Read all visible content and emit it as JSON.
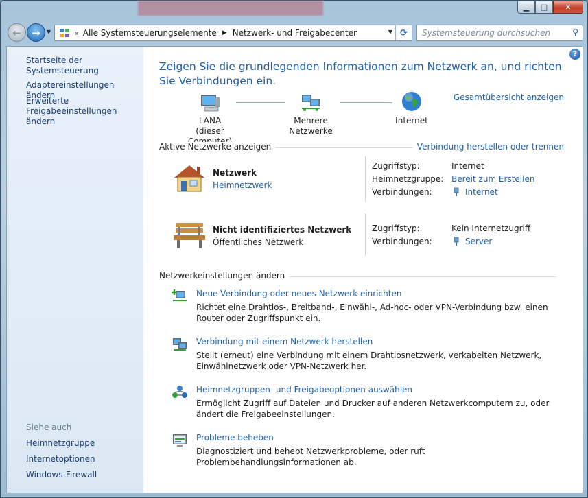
{
  "window": {
    "controls": {
      "minimize": "▁",
      "maximize": "□",
      "close": "✕"
    }
  },
  "nav": {
    "back_icon": "←",
    "forward_icon": "→",
    "recent_icon": "▼",
    "address_chevron": "«",
    "breadcrumbs": [
      "Alle Systemsteuerungselemente",
      "Netzwerk- und Freigabecenter"
    ],
    "crumb_separator": "▶",
    "dropdown_icon": "▼",
    "refresh_icon": "⟳",
    "search_placeholder": "Systemsteuerung durchsuchen",
    "search_icon": "⚲"
  },
  "sidebar": {
    "home": "Startseite der Systemsteuerung",
    "adapter": "Adaptereinstellungen ändern",
    "sharing": "Erweiterte Freigabeeinstellungen ändern",
    "see_also": "Siehe auch",
    "see_also_links": [
      "Heimnetzgruppe",
      "Internetoptionen",
      "Windows-Firewall"
    ]
  },
  "help_icon": "?",
  "main": {
    "title": "Zeigen Sie die grundlegenden Informationen zum Netzwerk an, und richten Sie Verbindungen ein.",
    "map": {
      "computer_line1": "LANA",
      "computer_line2": "(dieser Computer)",
      "network": "Mehrere Netzwerke",
      "internet": "Internet",
      "full_map_link": "Gesamtübersicht anzeigen"
    },
    "active_networks": {
      "heading": "Aktive Netzwerke anzeigen",
      "connect_link": "Verbindung herstellen oder trennen",
      "networks": [
        {
          "name": "Netzwerk",
          "type": "Heimnetzwerk",
          "access_label": "Zugriffstyp:",
          "access_value": "Internet",
          "homegroup_label": "Heimnetzgruppe:",
          "homegroup_value": "Bereit zum Erstellen",
          "connections_label": "Verbindungen:",
          "connections_value": "Internet"
        },
        {
          "name": "Nicht identifiziertes Netzwerk",
          "type": "Öffentliches Netzwerk",
          "access_label": "Zugriffstyp:",
          "access_value": "Kein Internetzugriff",
          "connections_label": "Verbindungen:",
          "connections_value": "Server"
        }
      ]
    },
    "settings": {
      "heading": "Netzwerkeinstellungen ändern",
      "tasks": [
        {
          "link": "Neue Verbindung oder neues Netzwerk einrichten",
          "desc": "Richtet eine Drahtlos-, Breitband-, Einwähl-, Ad-hoc- oder VPN-Verbindung bzw. einen Router oder Zugriffspunkt ein."
        },
        {
          "link": "Verbindung mit einem Netzwerk herstellen",
          "desc": "Stellt (erneut) eine Verbindung mit einem Drahtlosnetzwerk, verkabelten Netzwerk, Einwählnetzwerk oder VPN-Netzwerk her."
        },
        {
          "link": "Heimnetzgruppen- und Freigabeoptionen auswählen",
          "desc": "Ermöglicht Zugriff auf Dateien und Drucker auf anderen Netzwerkcomputern zu, oder ändert die Freigabeeinstellungen."
        },
        {
          "link": "Probleme beheben",
          "desc": "Diagnostiziert und behebt Netzwerkprobleme, oder ruft Problembehandlungsinformationen ab."
        }
      ]
    }
  }
}
